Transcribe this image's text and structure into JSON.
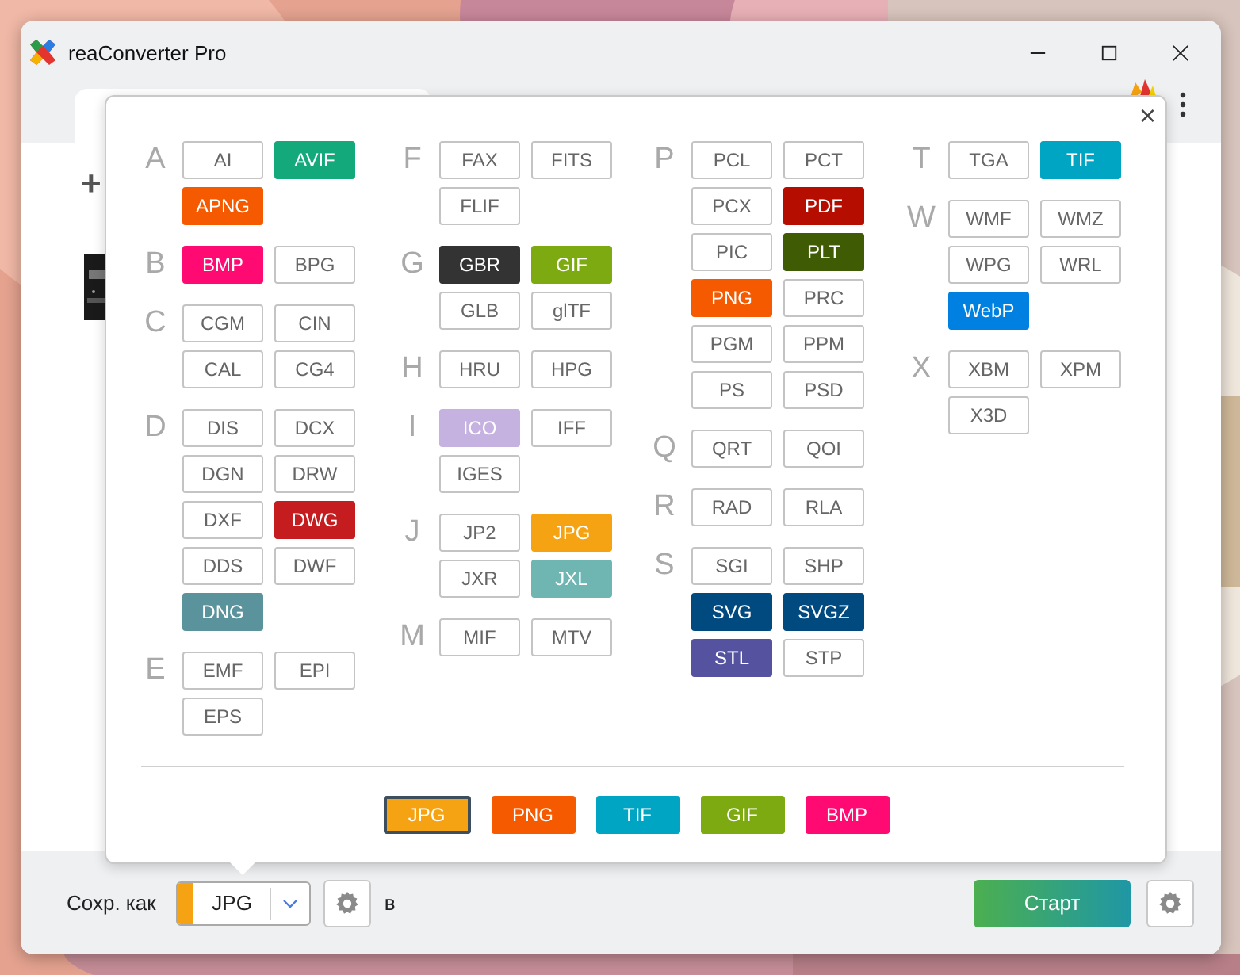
{
  "window": {
    "title": "reaConverter Pro"
  },
  "file_list": {
    "add": "+"
  },
  "format_picker": {
    "close": "×",
    "columns": [
      [
        {
          "letter": "A",
          "formats": [
            {
              "label": "AI"
            },
            {
              "label": "AVIF",
              "color": "#13a97b"
            },
            {
              "label": "APNG",
              "color": "#f55a00"
            }
          ]
        },
        {
          "letter": "B",
          "formats": [
            {
              "label": "BMP",
              "color": "#ff0a73"
            },
            {
              "label": "BPG"
            }
          ]
        },
        {
          "letter": "C",
          "formats": [
            {
              "label": "CGM"
            },
            {
              "label": "CIN"
            },
            {
              "label": "CAL"
            },
            {
              "label": "CG4"
            }
          ]
        },
        {
          "letter": "D",
          "formats": [
            {
              "label": "DIS"
            },
            {
              "label": "DCX"
            },
            {
              "label": "DGN"
            },
            {
              "label": "DRW"
            },
            {
              "label": "DXF"
            },
            {
              "label": "DWG",
              "color": "#c51d1f"
            },
            {
              "label": "DDS"
            },
            {
              "label": "DWF"
            },
            {
              "label": "DNG",
              "color": "#5a939c"
            }
          ]
        },
        {
          "letter": "E",
          "formats": [
            {
              "label": "EMF"
            },
            {
              "label": "EPI"
            },
            {
              "label": "EPS"
            }
          ]
        }
      ],
      [
        {
          "letter": "F",
          "formats": [
            {
              "label": "FAX"
            },
            {
              "label": "FITS"
            },
            {
              "label": "FLIF"
            }
          ]
        },
        {
          "letter": "G",
          "formats": [
            {
              "label": "GBR",
              "color": "#333333"
            },
            {
              "label": "GIF",
              "color": "#7daa10"
            },
            {
              "label": "GLB"
            },
            {
              "label": "glTF"
            }
          ]
        },
        {
          "letter": "H",
          "formats": [
            {
              "label": "HRU"
            },
            {
              "label": "HPG"
            }
          ]
        },
        {
          "letter": "I",
          "formats": [
            {
              "label": "ICO",
              "color": "#c5b2e0"
            },
            {
              "label": "IFF"
            },
            {
              "label": "IGES"
            }
          ]
        },
        {
          "letter": "J",
          "formats": [
            {
              "label": "JP2"
            },
            {
              "label": "JPG",
              "color": "#f5a312"
            },
            {
              "label": "JXR"
            },
            {
              "label": "JXL",
              "color": "#6fb6b3"
            }
          ]
        },
        {
          "letter": "M",
          "formats": [
            {
              "label": "MIF"
            },
            {
              "label": "MTV"
            }
          ]
        }
      ],
      [
        {
          "letter": "P",
          "formats": [
            {
              "label": "PCL"
            },
            {
              "label": "PCT"
            },
            {
              "label": "PCX"
            },
            {
              "label": "PDF",
              "color": "#b50e00"
            },
            {
              "label": "PIC"
            },
            {
              "label": "PLT",
              "color": "#3f5c05"
            },
            {
              "label": "PNG",
              "color": "#f55a00"
            },
            {
              "label": "PRC"
            },
            {
              "label": "PGM"
            },
            {
              "label": "PPM"
            },
            {
              "label": "PS"
            },
            {
              "label": "PSD"
            }
          ]
        },
        {
          "letter": "Q",
          "formats": [
            {
              "label": "QRT"
            },
            {
              "label": "QOI"
            }
          ]
        },
        {
          "letter": "R",
          "formats": [
            {
              "label": "RAD"
            },
            {
              "label": "RLA"
            }
          ]
        },
        {
          "letter": "S",
          "formats": [
            {
              "label": "SGI"
            },
            {
              "label": "SHP"
            },
            {
              "label": "SVG",
              "color": "#004a80"
            },
            {
              "label": "SVGZ",
              "color": "#004a80"
            },
            {
              "label": "STL",
              "color": "#5553a0"
            },
            {
              "label": "STP"
            }
          ]
        }
      ],
      [
        {
          "letter": "T",
          "formats": [
            {
              "label": "TGA"
            },
            {
              "label": "TIF",
              "color": "#00a5c4"
            }
          ]
        },
        {
          "letter": "W",
          "formats": [
            {
              "label": "WMF"
            },
            {
              "label": "WMZ"
            },
            {
              "label": "WPG"
            },
            {
              "label": "WRL"
            },
            {
              "label": "WebP",
              "color": "#0080e0"
            }
          ]
        },
        {
          "letter": "X",
          "formats": [
            {
              "label": "XBM"
            },
            {
              "label": "XPM"
            },
            {
              "label": "X3D"
            }
          ]
        }
      ]
    ],
    "quick_formats": [
      {
        "label": "JPG",
        "color": "#f5a312",
        "selected": true
      },
      {
        "label": "PNG",
        "color": "#f55a00",
        "selected": false
      },
      {
        "label": "TIF",
        "color": "#00a5c4",
        "selected": false
      },
      {
        "label": "GIF",
        "color": "#7daa10",
        "selected": false
      },
      {
        "label": "BMP",
        "color": "#ff0a73",
        "selected": false
      }
    ]
  },
  "save_bar": {
    "label": "Сохр. как",
    "format": {
      "value": "JPG",
      "color": "#f5a312"
    },
    "folder_label": "в",
    "start_button": "Старт"
  }
}
